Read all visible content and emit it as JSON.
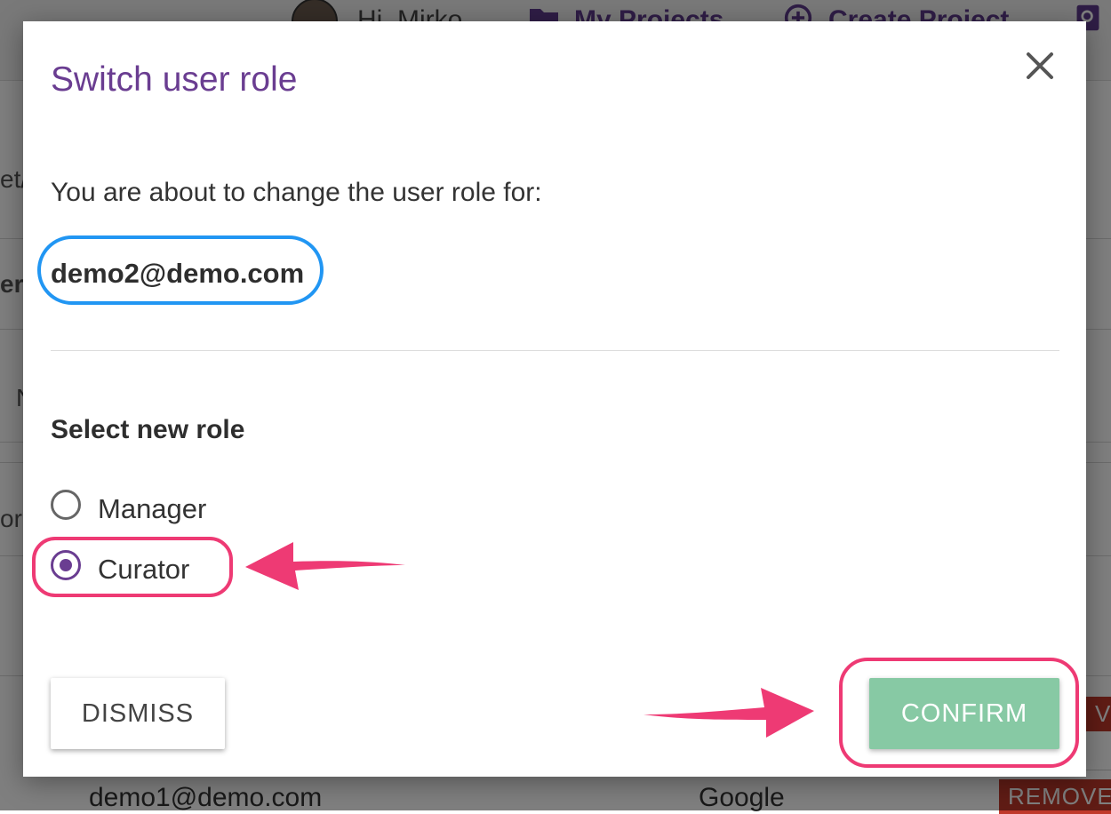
{
  "background": {
    "greeting": "Hi, Mirko",
    "nav": {
      "my_projects": "My Projects",
      "create_project": "Create Project"
    },
    "side_fragments": [
      "et/",
      "ers",
      "N",
      "or"
    ],
    "row": {
      "email": "demo1@demo.com",
      "provider": "Google",
      "remove_label": "REMOVE"
    },
    "remove_partial": "VE"
  },
  "modal": {
    "title": "Switch user role",
    "close_icon": "close-icon",
    "intro": "You are about to change the user role for:",
    "email": "demo2@demo.com",
    "role_heading": "Select new role",
    "roles": [
      {
        "label": "Manager",
        "checked": false
      },
      {
        "label": "Curator",
        "checked": true
      }
    ],
    "dismiss_label": "DISMISS",
    "confirm_label": "CONFIRM"
  },
  "colors": {
    "title": "#6a3d91",
    "radio_checked": "#6a3d91",
    "confirm_button": "#87c9a4",
    "highlight_pink": "#ee3a74",
    "highlight_blue": "#2196f3"
  }
}
